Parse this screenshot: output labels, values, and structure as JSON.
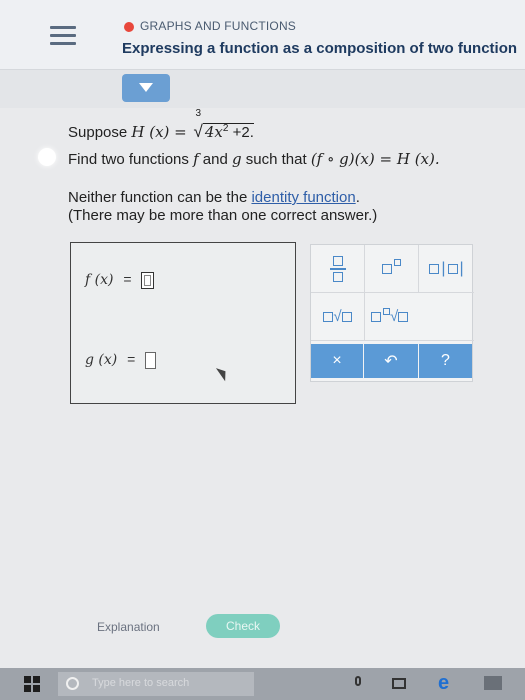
{
  "header": {
    "topic": "GRAPHS AND FUNCTIONS",
    "title": "Expressing a function as a composition of two function"
  },
  "question": {
    "suppose_prefix": "Suppose ",
    "H_def_lhs": "H (x) = ",
    "root_index": "3",
    "radicand_term": "4x",
    "radicand_exp": "2",
    "radicand_tail": " +2.",
    "line2_prefix": "Find two functions ",
    "line2_f": "f",
    "line2_and": " and ",
    "line2_g": "g",
    "line2_such": " such that ",
    "line2_expr": "(f ∘ g)(x) = H (x).",
    "note_prefix": "Neither function can be the ",
    "note_link": "identity function",
    "note_suffix": ".",
    "note_line2": "(There may be more than one correct answer.)"
  },
  "answers": {
    "f_label": "f (x)",
    "g_label": "g (x)",
    "equals": "="
  },
  "palette": {
    "clear_symbol": "×",
    "undo_symbol": "↶",
    "help_symbol": "?",
    "sqrt_symbol": "√",
    "abs_symbol": "|"
  },
  "footer": {
    "explanation_label": "Explanation",
    "check_label": "Check"
  },
  "taskbar": {
    "search_placeholder": "Type here to search",
    "edge_glyph": "e"
  },
  "colors": {
    "accent": "#5b9ad6",
    "topic_dot": "#e8473b",
    "check": "#7fcfbf"
  }
}
